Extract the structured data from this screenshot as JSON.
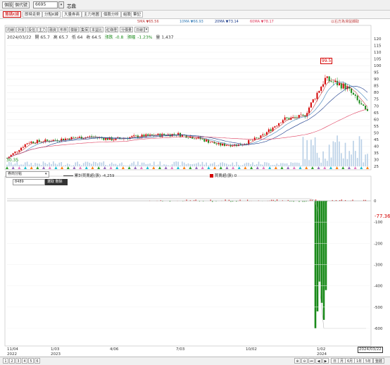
{
  "toolbar": {
    "menu_btn": "個股",
    "code_btn": "個代號",
    "code_value": "6695",
    "stock_name": "芯鼎"
  },
  "tabs": [
    {
      "label": "籌碼K線",
      "active": true
    },
    {
      "label": "即時走勢",
      "active": false
    },
    {
      "label": "分點K線",
      "active": false
    },
    {
      "label": "大量券商",
      "active": false
    },
    {
      "label": "主力地圖",
      "active": false
    },
    {
      "label": "個股分析",
      "active": false
    },
    {
      "label": "組股",
      "active": false
    },
    {
      "label": "筆記",
      "active": false
    }
  ],
  "ma": {
    "ma5": "5MA ▼65.56",
    "ma10": "10MA ▼66.93",
    "ma20": "20MA ▼73.14",
    "ma60": "60MA ▼78.17",
    "note": "以右方為滑鼠擷取"
  },
  "small_buttons": [
    "均線",
    "外資",
    "投信",
    "主力",
    "融資",
    "布林",
    "樣貌",
    "集保",
    "本益比",
    "紅綠燈",
    "分價量",
    "日線"
  ],
  "info": {
    "date": "2024/03/22",
    "open": "開 65.7",
    "high": "高 65.7",
    "low": "低 64",
    "close": "收 64.5",
    "change_label": "漲跌",
    "change": "-0.8",
    "pct_label": "漲幅",
    "pct": "-1.23%",
    "vol": "量 1,437"
  },
  "panel2": {
    "select": "券商分點",
    "branch_code": "8489",
    "action_btn": "選取 刪除",
    "cum_label": "累計買賣超(張)",
    "cum_value": "-4,259",
    "day_label": "買賣超(張)",
    "day_value": "0"
  },
  "peak_label": "99.5",
  "low_label": "30.35",
  "current_sub": "-77.36",
  "date_badge": "2024/03/22",
  "pages": [
    "1",
    "2",
    "3",
    "4",
    "5",
    "6"
  ],
  "periods": [
    "日",
    "月",
    "6月",
    "1年",
    "5年",
    "整體"
  ],
  "colors": {
    "up": "#d40000",
    "down": "#1a8a1a",
    "ma5": "#c04040",
    "ma10": "#3a7fb8",
    "ma20": "#1a3a8a",
    "ma60": "#e04060"
  },
  "chart_data": [
    {
      "type": "line",
      "title": "",
      "y_axis_ticks": [
        120,
        115,
        110,
        105,
        100,
        95,
        90,
        85,
        80,
        75,
        70,
        65,
        60,
        55,
        50,
        45,
        40,
        35,
        30,
        25
      ],
      "x_ticks": [
        "11/04 2022",
        "1/03 2023",
        "4/06",
        "7/03",
        "10/02",
        "1/02 2024",
        "2024/03/22"
      ],
      "close_series": [
        {
          "x": "11/04 2022",
          "y": 31
        },
        {
          "x": "12/2022",
          "y": 43
        },
        {
          "x": "1/03 2023",
          "y": 44
        },
        {
          "x": "2/2023",
          "y": 46
        },
        {
          "x": "3/2023",
          "y": 47
        },
        {
          "x": "4/06",
          "y": 45
        },
        {
          "x": "5/2023",
          "y": 47
        },
        {
          "x": "6/2023",
          "y": 48
        },
        {
          "x": "7/03",
          "y": 49
        },
        {
          "x": "8/2023",
          "y": 46
        },
        {
          "x": "9/2023",
          "y": 41
        },
        {
          "x": "10/02",
          "y": 41
        },
        {
          "x": "11/2023",
          "y": 47
        },
        {
          "x": "12/2023",
          "y": 60
        },
        {
          "x": "1/02 2024",
          "y": 62
        },
        {
          "x": "2/2024",
          "y": 90
        },
        {
          "x": "3/01 2024",
          "y": 84
        },
        {
          "x": "2024/03/22",
          "y": 64.5
        }
      ]
    },
    {
      "type": "bar",
      "title": "",
      "y_axis_ticks": [
        0,
        -100,
        -200,
        -300,
        -400,
        -500,
        -600
      ],
      "series": [
        {
          "name": "買賣超(張)",
          "values": [
            {
              "x": "2024/01/15",
              "y": -600
            },
            {
              "x": "2024/01/18",
              "y": -520
            },
            {
              "x": "2024/01/22",
              "y": -380
            },
            {
              "x": "2024/01/25",
              "y": -480
            },
            {
              "x": "2024/01/29",
              "y": -560
            },
            {
              "x": "2024/02/01",
              "y": -420
            }
          ]
        }
      ]
    }
  ]
}
